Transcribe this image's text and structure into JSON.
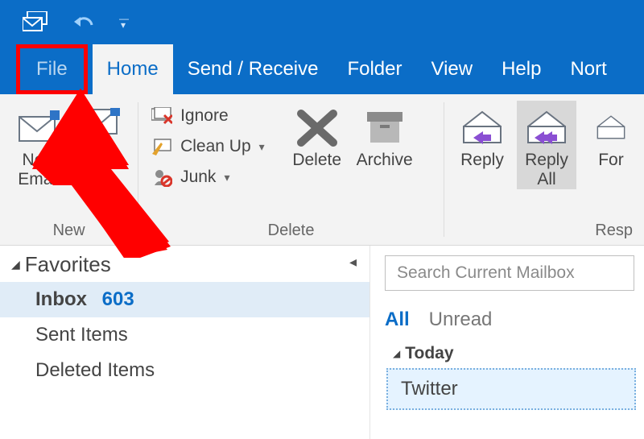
{
  "tabs": {
    "file": "File",
    "home": "Home",
    "sendreceive": "Send / Receive",
    "folder": "Folder",
    "view": "View",
    "help": "Help",
    "norton": "Nort"
  },
  "ribbon": {
    "new_group_label": "New",
    "new_email_line1": "New",
    "new_email_line2": "Email",
    "ignore": "Ignore",
    "cleanup": "Clean Up",
    "junk": "Junk",
    "delete_group_label": "Delete",
    "delete_btn": "Delete",
    "archive": "Archive",
    "reply": "Reply",
    "reply_all_line1": "Reply",
    "reply_all_line2": "All",
    "forward": "For",
    "respond_group_label": "Resp"
  },
  "nav": {
    "favorites": "Favorites",
    "inbox": "Inbox",
    "inbox_count": "603",
    "sent": "Sent Items",
    "deleted": "Deleted Items"
  },
  "read": {
    "search_placeholder": "Search Current Mailbox",
    "filter_all": "All",
    "filter_unread": "Unread",
    "group_today": "Today",
    "msg_twitter": "Twitter"
  }
}
